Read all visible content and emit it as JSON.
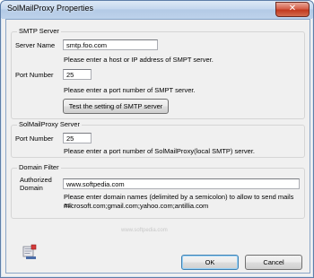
{
  "window": {
    "title": "SolMailProxy Properties",
    "close_label": "✕"
  },
  "smtp": {
    "legend": "SMTP Server",
    "server_label": "Server Name",
    "server_value": "smtp.foo.com",
    "server_hint": "Please enter a host or IP address of SMPT server.",
    "port_label": "Port Number",
    "port_value": "25",
    "port_hint": "Please enter a port number of SMPT server.",
    "test_button": "Test the setting of SMTP server"
  },
  "proxy": {
    "legend": "SolMailProxy Server",
    "port_label": "Port Number",
    "port_value": "25",
    "port_hint": "Please enter a port number of SolMailProxy(local SMTP) server."
  },
  "domain": {
    "legend": "Domain Filter",
    "label_line1": "Authorized",
    "label_line2": "Domain",
    "value": "www.softpedia.com",
    "hint_line1": "Please enter domain names (delimited by a semicolon) to allow to send mails as:",
    "hint_line2": "microsoft.com;gmail.com;yahoo.com;antillia.com"
  },
  "footer": {
    "ok_label": "OK",
    "cancel_label": "Cancel",
    "watermark": "www.softpedia.com"
  },
  "icons": {
    "app": "mail-proxy-icon",
    "close": "close-icon"
  },
  "colors": {
    "title_bar": "#bcd1ea",
    "close_button": "#c23a20",
    "dialog_bg": "#f0f0f0"
  }
}
